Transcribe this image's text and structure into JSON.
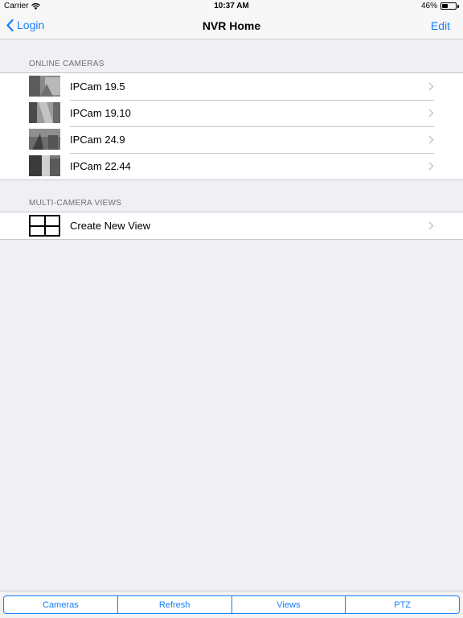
{
  "status_bar": {
    "carrier": "Carrier",
    "time": "10:37 AM",
    "battery_percent": "46%",
    "battery_level": 0.46
  },
  "nav": {
    "back_label": "Login",
    "title": "NVR Home",
    "edit_label": "Edit"
  },
  "online_cameras": {
    "header": "ONLINE CAMERAS",
    "items": [
      {
        "label": "IPCam 19.5"
      },
      {
        "label": "IPCam 19.10"
      },
      {
        "label": "IPCam 24.9"
      },
      {
        "label": "IPCam 22.44"
      }
    ]
  },
  "multi_camera_views": {
    "header": "MULTI-CAMERA VIEWS",
    "items": [
      {
        "label": "Create New View"
      }
    ]
  },
  "toolbar": {
    "segments": [
      "Cameras",
      "Refresh",
      "Views",
      "PTZ"
    ]
  },
  "colors": {
    "accent": "#157efb",
    "background": "#efeff4",
    "separator": "#c8c7cc"
  }
}
